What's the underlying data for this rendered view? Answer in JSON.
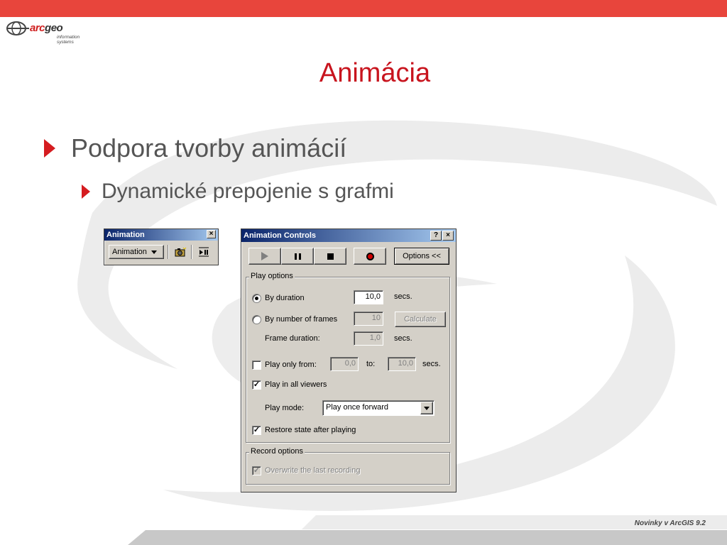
{
  "logo": {
    "word_arc": "arc",
    "word_geo": "geo",
    "sub_line1": "information",
    "sub_line2": "systems"
  },
  "slide": {
    "title": "Animácia",
    "bullet1": "Podpora tvorby animácií",
    "bullet2": "Dynamické prepojenie s grafmi",
    "footer": "Novinky v ArcGIS 9.2"
  },
  "toolbar": {
    "title": "Animation",
    "close": "×",
    "dropdown_label": "Animation"
  },
  "dialog": {
    "title": "Animation Controls",
    "help": "?",
    "close": "×",
    "options_button": "Options <<",
    "play_options": {
      "label": "Play options",
      "by_duration": "By duration",
      "duration_value": "10,0",
      "secs1": "secs.",
      "by_frames": "By number of frames",
      "frames_value": "10",
      "calculate": "Calculate",
      "frame_duration": "Frame duration:",
      "frame_duration_value": "1,0",
      "secs2": "secs.",
      "play_only_from": "Play only from:",
      "from_value": "0,0",
      "to": "to:",
      "to_value": "10,0",
      "secs3": "secs.",
      "play_all_viewers": "Play in all viewers",
      "play_mode": "Play mode:",
      "play_mode_value": "Play once forward",
      "restore_state": "Restore state after playing"
    },
    "record_options": {
      "label": "Record options",
      "overwrite": "Overwrite the last recording"
    }
  },
  "colors": {
    "topbar": "#e8453c",
    "title": "#c8141e",
    "bullet_arrow": "#d51c20",
    "text": "#555555"
  }
}
